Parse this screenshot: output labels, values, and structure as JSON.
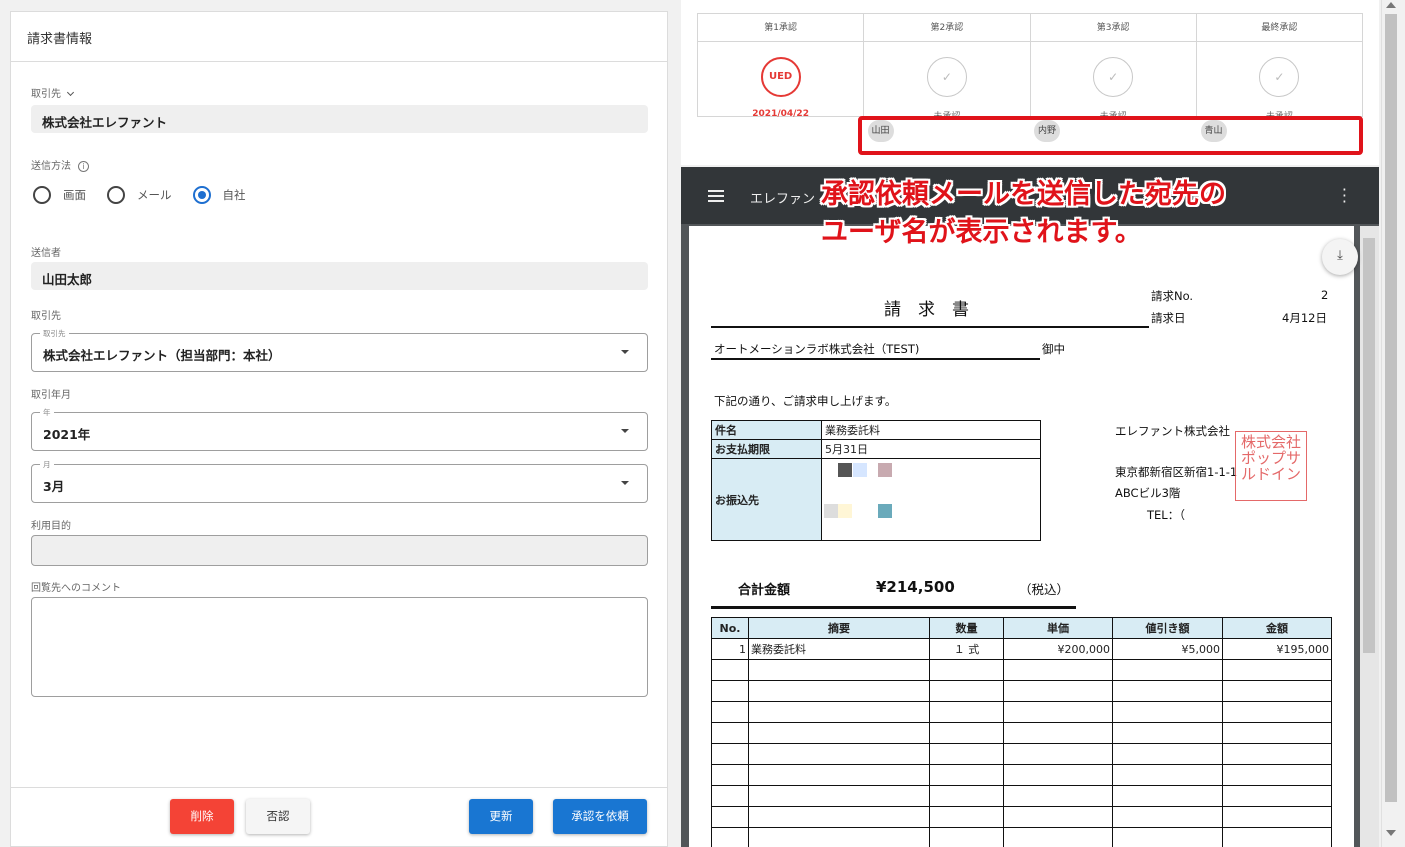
{
  "form": {
    "title": "請求書情報",
    "client_label": "取引先",
    "client_value": "株式会社エレファント",
    "send_method_label": "送信方法",
    "send_methods": [
      "画面",
      "メール",
      "自社"
    ],
    "send_method_selected": "自社",
    "sender_label": "送信者",
    "sender_value": "山田太郎",
    "client2_label": "取引先",
    "client2_legend": "取引先",
    "client2_value": "株式会社エレファント（担当部門：本社）",
    "period_label": "取引年月",
    "year_legend": "年",
    "year_value": "2021年",
    "month_legend": "月",
    "month_value": "3月",
    "purpose_label": "利用目的",
    "purpose_value": "",
    "comment_label": "回覧先へのコメント",
    "comment_value": ""
  },
  "buttons": {
    "delete": "削除",
    "reject": "否認",
    "update": "更新",
    "request": "承認を依頼",
    "colors": {
      "delete": "#f44336",
      "reject": "#f5f5f5",
      "update": "#1976d2",
      "request": "#1976d2"
    }
  },
  "approval": {
    "steps": [
      {
        "header": "第1承認",
        "status": "2021/04/22",
        "stamp": "UED",
        "done": true,
        "user": ""
      },
      {
        "header": "第2承認",
        "status": "未承認",
        "stamp": "✓",
        "done": false,
        "user": "山田"
      },
      {
        "header": "第3承認",
        "status": "未承認",
        "stamp": "✓",
        "done": false,
        "user": "内野"
      },
      {
        "header": "最終承認",
        "status": "未承認",
        "stamp": "✓",
        "done": false,
        "user": "青山"
      }
    ],
    "highlight_color": "#e0131a"
  },
  "callout": {
    "line1": "承認依頼メールを送信した宛先の",
    "line2": "ユーザ名が表示されます。"
  },
  "viewer": {
    "title": "エレファン",
    "menu_icon": "more-vert-icon",
    "download_icon": "download-icon"
  },
  "invoice": {
    "title": "請　求　書",
    "no_label": "請求No.",
    "no_value": "2",
    "date_label": "請求日",
    "date_value": "4月12日",
    "recipient": "オートメーションラボ株式会社（TEST)",
    "honorific": "御中",
    "intro": "下記の通り、ご請求申し上げます。",
    "meta": [
      {
        "key": "件名",
        "value": "業務委託料"
      },
      {
        "key": "お支払期限",
        "value": "5月31日"
      },
      {
        "key": "お振込先",
        "value": ""
      }
    ],
    "issuer": {
      "name": "エレファント株式会社",
      "address": "東京都新宿区新宿1-1-1",
      "building": "ABCビル3階",
      "tel": "TEL：（"
    },
    "seal_text": "株式会社ポップサルドイン",
    "total_label": "合計金額",
    "total_value": "¥214,500",
    "tax_note": "（税込）",
    "columns": [
      "No.",
      "摘要",
      "数量",
      "単価",
      "値引き額",
      "金額"
    ],
    "rows": [
      [
        "1",
        "業務委託料",
        "１ 式",
        "¥200,000",
        "¥5,000",
        "¥195,000"
      ],
      [
        "",
        "",
        "",
        "",
        "",
        ""
      ],
      [
        "",
        "",
        "",
        "",
        "",
        ""
      ],
      [
        "",
        "",
        "",
        "",
        "",
        ""
      ],
      [
        "",
        "",
        "",
        "",
        "",
        ""
      ],
      [
        "",
        "",
        "",
        "",
        "",
        ""
      ],
      [
        "",
        "",
        "",
        "",
        "",
        ""
      ],
      [
        "",
        "",
        "",
        "",
        "",
        ""
      ],
      [
        "",
        "",
        "",
        "",
        "",
        ""
      ],
      [
        "",
        "",
        "",
        "",
        "",
        ""
      ],
      [
        "",
        "",
        "",
        "",
        "",
        ""
      ]
    ]
  }
}
